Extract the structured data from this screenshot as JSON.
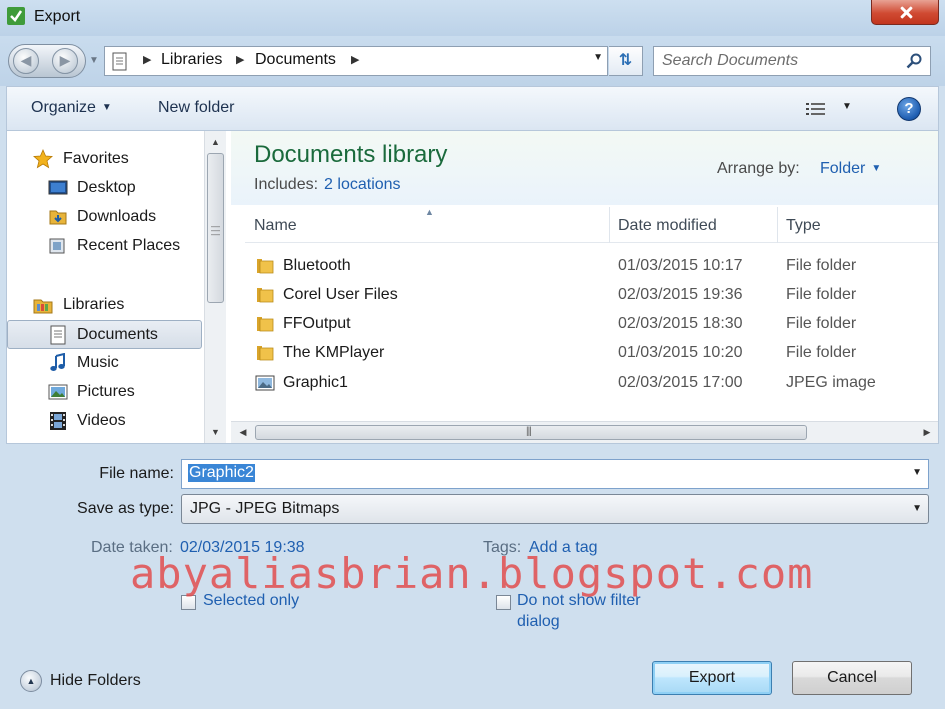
{
  "window": {
    "title": "Export"
  },
  "address": {
    "crumbs": [
      "Libraries",
      "Documents"
    ],
    "search_placeholder": "Search Documents"
  },
  "toolbar": {
    "organize_label": "Organize",
    "new_folder_label": "New folder",
    "help_label": "?"
  },
  "nav": {
    "favorites_label": "Favorites",
    "favorites": [
      "Desktop",
      "Downloads",
      "Recent Places"
    ],
    "libraries_label": "Libraries",
    "libraries": [
      "Documents",
      "Music",
      "Pictures",
      "Videos"
    ],
    "selected": "Documents"
  },
  "library": {
    "title": "Documents library",
    "includes_label": "Includes:",
    "includes_link": "2 locations",
    "arrange_label": "Arrange by:",
    "arrange_value": "Folder"
  },
  "columns": [
    "Name",
    "Date modified",
    "Type"
  ],
  "files": [
    {
      "name": "Bluetooth",
      "date": "01/03/2015 10:17",
      "type": "File folder",
      "icon": "folder-icon"
    },
    {
      "name": "Corel User Files",
      "date": "02/03/2015 19:36",
      "type": "File folder",
      "icon": "folder-icon"
    },
    {
      "name": "FFOutput",
      "date": "02/03/2015 18:30",
      "type": "File folder",
      "icon": "folder-icon"
    },
    {
      "name": "The KMPlayer",
      "date": "01/03/2015 10:20",
      "type": "File folder",
      "icon": "folder-icon"
    },
    {
      "name": "Graphic1",
      "date": "02/03/2015 17:00",
      "type": "JPEG image",
      "icon": "image-file-icon"
    }
  ],
  "save": {
    "filename_label": "File name:",
    "filename_value": "Graphic2",
    "type_label": "Save as type:",
    "type_value": "JPG - JPEG Bitmaps",
    "date_taken_label": "Date taken:",
    "date_taken_value": "02/03/2015 19:38",
    "tags_label": "Tags:",
    "tags_value": "Add a tag",
    "selected_only_label": "Selected only",
    "no_filter_label_line1": "Do not show filter",
    "no_filter_label_line2": "dialog"
  },
  "watermark": "abyaliasbrian.blogspot.com",
  "footer": {
    "hide_folders_label": "Hide Folders",
    "export_label": "Export",
    "cancel_label": "Cancel"
  },
  "colors": {
    "library_title": "#1a6a3c",
    "link": "#1f5fb0",
    "selection": "#3a86d6",
    "close_button": "#d04a32"
  }
}
